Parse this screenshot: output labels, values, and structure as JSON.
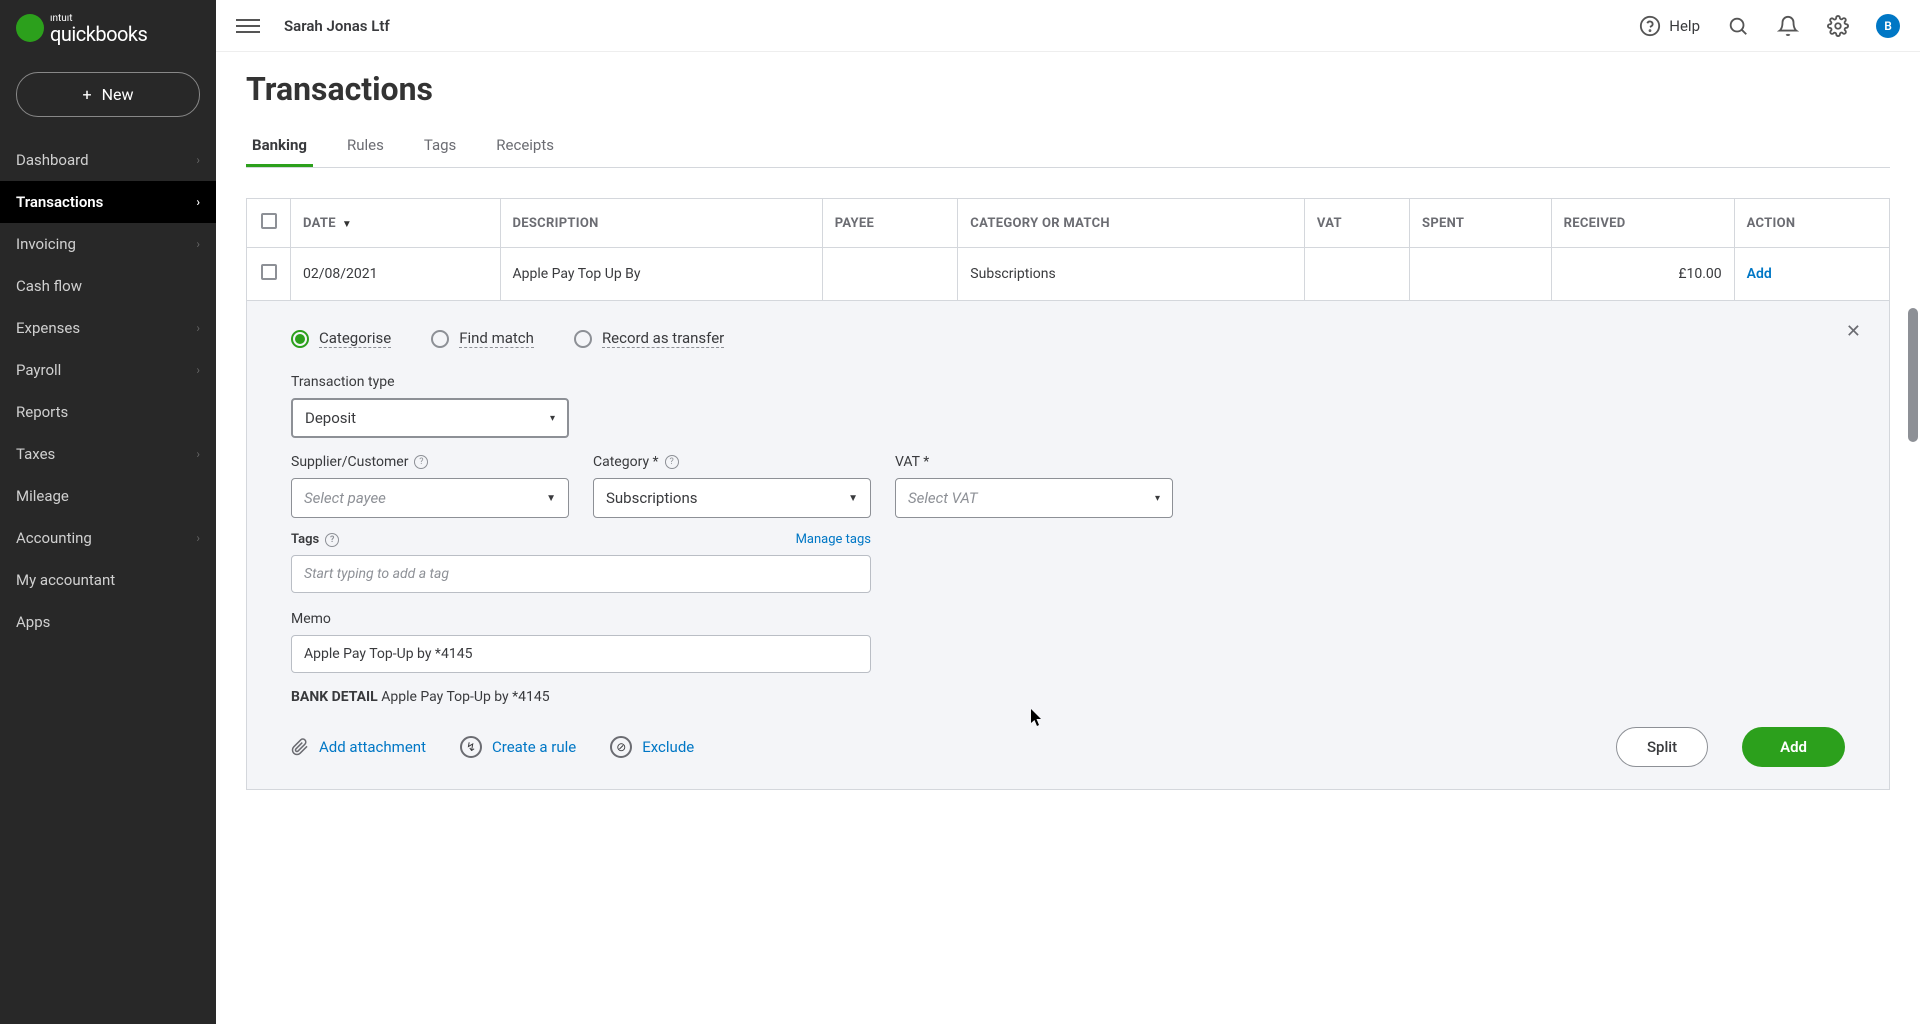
{
  "brand": {
    "small": "ıntuıt",
    "name": "quickbooks"
  },
  "new_button": "New",
  "sidebar": {
    "items": [
      {
        "label": "Dashboard",
        "hasChevron": true
      },
      {
        "label": "Transactions",
        "hasChevron": true,
        "active": true
      },
      {
        "label": "Invoicing",
        "hasChevron": true
      },
      {
        "label": "Cash flow",
        "hasChevron": false
      },
      {
        "label": "Expenses",
        "hasChevron": true
      },
      {
        "label": "Payroll",
        "hasChevron": true
      },
      {
        "label": "Reports",
        "hasChevron": false
      },
      {
        "label": "Taxes",
        "hasChevron": true
      },
      {
        "label": "Mileage",
        "hasChevron": false
      },
      {
        "label": "Accounting",
        "hasChevron": true
      },
      {
        "label": "My accountant",
        "hasChevron": false
      },
      {
        "label": "Apps",
        "hasChevron": false
      }
    ]
  },
  "header": {
    "company_name": "Sarah Jonas Ltf",
    "help_label": "Help",
    "avatar_initial": "B"
  },
  "page": {
    "title": "Transactions",
    "tabs": [
      "Banking",
      "Rules",
      "Tags",
      "Receipts"
    ],
    "active_tab_index": 0
  },
  "table": {
    "columns": [
      "DATE",
      "DESCRIPTION",
      "PAYEE",
      "CATEGORY OR MATCH",
      "VAT",
      "SPENT",
      "RECEIVED",
      "ACTION"
    ],
    "row": {
      "date": "02/08/2021",
      "description": "Apple Pay Top Up By",
      "payee": "",
      "category": "Subscriptions",
      "vat": "",
      "spent": "",
      "received": "£10.00",
      "action": "Add"
    }
  },
  "detail": {
    "radios": [
      "Categorise",
      "Find match",
      "Record as transfer"
    ],
    "selected_radio": 0,
    "transaction_type_label": "Transaction type",
    "transaction_type_value": "Deposit",
    "supplier_label": "Supplier/Customer",
    "supplier_placeholder": "Select payee",
    "category_label": "Category *",
    "category_value": "Subscriptions",
    "vat_label": "VAT *",
    "vat_placeholder": "Select VAT",
    "tags_label": "Tags",
    "manage_tags": "Manage tags",
    "tags_placeholder": "Start typing to add a tag",
    "memo_label": "Memo",
    "memo_value": "Apple Pay Top-Up by *4145",
    "bank_detail_label": "BANK DETAIL",
    "bank_detail_value": "Apple Pay Top-Up by *4145",
    "add_attachment": "Add attachment",
    "create_rule": "Create a rule",
    "exclude": "Exclude",
    "split_button": "Split",
    "add_button": "Add"
  }
}
